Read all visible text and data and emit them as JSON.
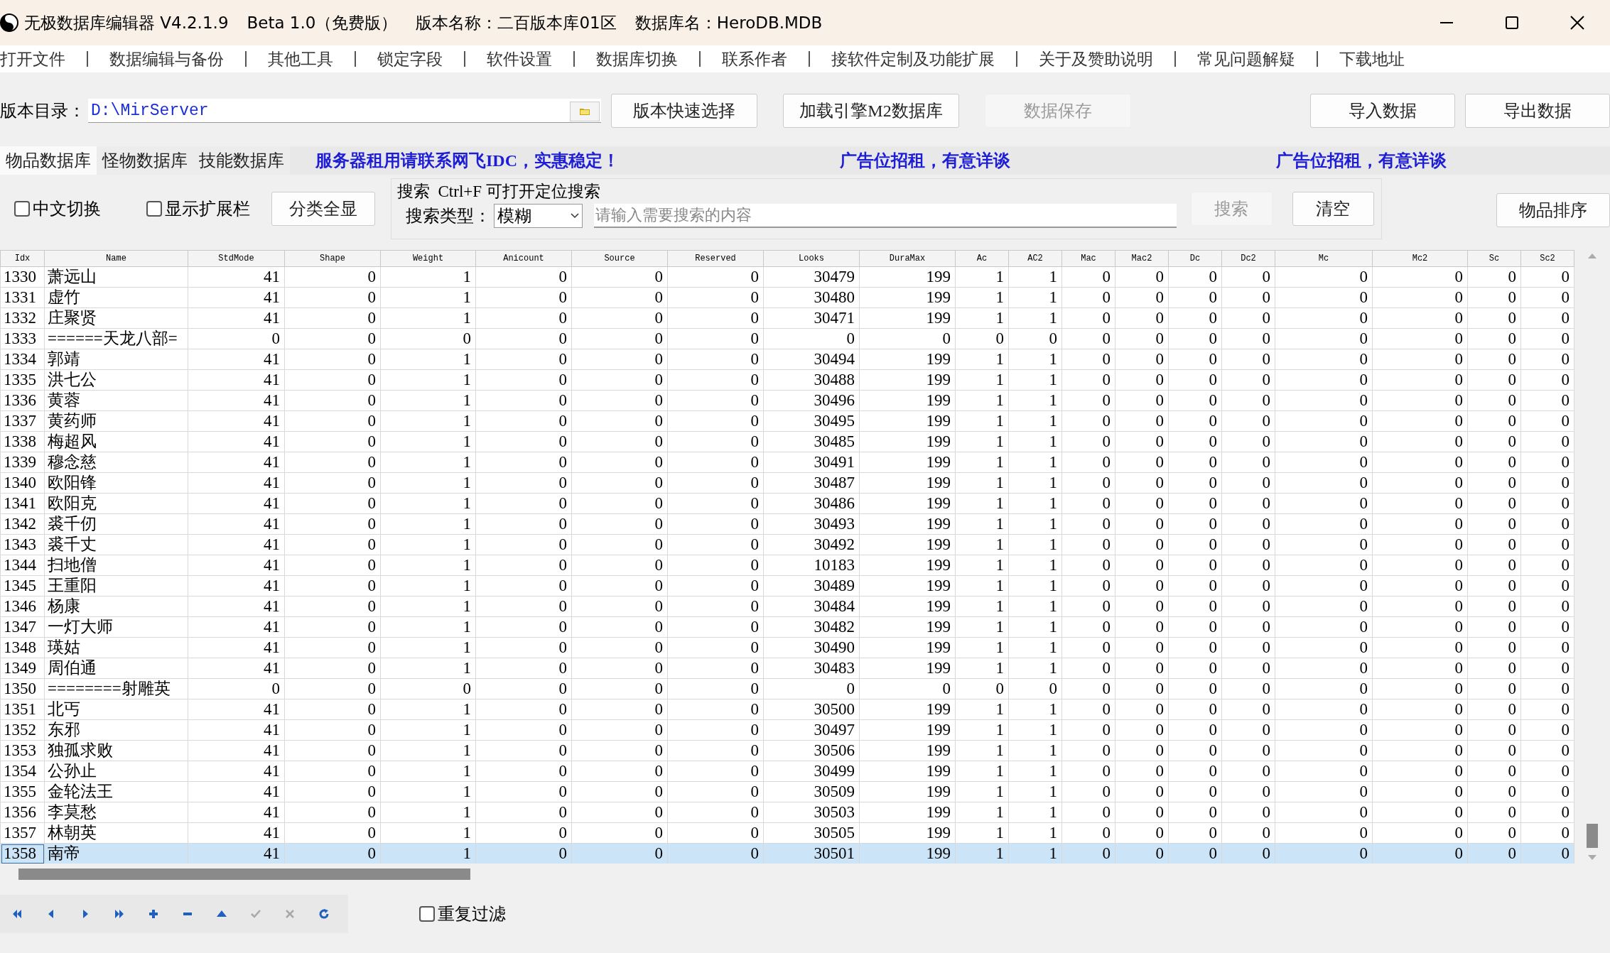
{
  "window": {
    "title": "无极数据库编辑器 V4.2.1.9",
    "edition": "Beta 1.0（免费版）",
    "version_label": "版本名称：二百版本库01区",
    "db_label": "数据库名：HeroDB.MDB"
  },
  "menu": [
    "打开文件",
    "数据编辑与备份",
    "其他工具",
    "锁定字段",
    "软件设置",
    "数据库切换",
    "联系作者",
    "接软件定制及功能扩展",
    "关于及赞助说明",
    "常见问题解疑",
    "下载地址"
  ],
  "toolbar": {
    "dir_label": "版本目录：",
    "dir_value": "D:\\MirServer",
    "buttons": [
      {
        "label": "版本快速选择",
        "disabled": false
      },
      {
        "label": "加载引擎M2数据库",
        "disabled": false
      },
      {
        "label": "数据保存",
        "disabled": true
      }
    ],
    "right_buttons": [
      {
        "label": "导入数据",
        "disabled": false
      },
      {
        "label": "导出数据",
        "disabled": false
      }
    ]
  },
  "tabs": [
    {
      "label": "物品数据库",
      "selected": true
    },
    {
      "label": "怪物数据库",
      "selected": false
    },
    {
      "label": "技能数据库",
      "selected": false
    }
  ],
  "ads": [
    "服务器租用请联系网飞IDC，实惠稳定！",
    "广告位招租，有意详谈",
    "广告位招租，有意详谈"
  ],
  "options": [
    {
      "label": "中文切换",
      "checked": false
    },
    {
      "label": "显示扩展栏",
      "checked": false
    }
  ],
  "show_all_button": "分类全显",
  "search": {
    "title": "搜索  Ctrl+F 可打开定位搜索",
    "type_label": "搜索类型：",
    "type_value": "模糊",
    "placeholder": "请输入需要搜索的内容",
    "buttons": [
      {
        "label": "搜索",
        "disabled": true
      },
      {
        "label": "清空",
        "disabled": false
      }
    ]
  },
  "sort_button": "物品排序",
  "table": {
    "columns": [
      "Idx",
      "Name",
      "StdMode",
      "Shape",
      "Weight",
      "Anicount",
      "Source",
      "Reserved",
      "Looks",
      "DuraMax",
      "Ac",
      "AC2",
      "Mac",
      "Mac2",
      "Dc",
      "Dc2",
      "Mc",
      "Mc2",
      "Sc",
      "Sc2"
    ],
    "rows": [
      {
        "selected": false,
        "cells": [
          "1330",
          "萧远山",
          "41",
          "0",
          "1",
          "0",
          "0",
          "0",
          "30479",
          "199",
          "1",
          "1",
          "0",
          "0",
          "0",
          "0",
          "0",
          "0",
          "0",
          "0"
        ]
      },
      {
        "selected": false,
        "cells": [
          "1331",
          "虚竹",
          "41",
          "0",
          "1",
          "0",
          "0",
          "0",
          "30480",
          "199",
          "1",
          "1",
          "0",
          "0",
          "0",
          "0",
          "0",
          "0",
          "0",
          "0"
        ]
      },
      {
        "selected": false,
        "cells": [
          "1332",
          "庄聚贤",
          "41",
          "0",
          "1",
          "0",
          "0",
          "0",
          "30471",
          "199",
          "1",
          "1",
          "0",
          "0",
          "0",
          "0",
          "0",
          "0",
          "0",
          "0"
        ]
      },
      {
        "selected": false,
        "cells": [
          "1333",
          "======天龙八部=",
          "0",
          "0",
          "0",
          "0",
          "0",
          "0",
          "0",
          "0",
          "0",
          "0",
          "0",
          "0",
          "0",
          "0",
          "0",
          "0",
          "0",
          "0"
        ]
      },
      {
        "selected": false,
        "cells": [
          "1334",
          "郭靖",
          "41",
          "0",
          "1",
          "0",
          "0",
          "0",
          "30494",
          "199",
          "1",
          "1",
          "0",
          "0",
          "0",
          "0",
          "0",
          "0",
          "0",
          "0"
        ]
      },
      {
        "selected": false,
        "cells": [
          "1335",
          "洪七公",
          "41",
          "0",
          "1",
          "0",
          "0",
          "0",
          "30488",
          "199",
          "1",
          "1",
          "0",
          "0",
          "0",
          "0",
          "0",
          "0",
          "0",
          "0"
        ]
      },
      {
        "selected": false,
        "cells": [
          "1336",
          "黄蓉",
          "41",
          "0",
          "1",
          "0",
          "0",
          "0",
          "30496",
          "199",
          "1",
          "1",
          "0",
          "0",
          "0",
          "0",
          "0",
          "0",
          "0",
          "0"
        ]
      },
      {
        "selected": false,
        "cells": [
          "1337",
          "黄药师",
          "41",
          "0",
          "1",
          "0",
          "0",
          "0",
          "30495",
          "199",
          "1",
          "1",
          "0",
          "0",
          "0",
          "0",
          "0",
          "0",
          "0",
          "0"
        ]
      },
      {
        "selected": false,
        "cells": [
          "1338",
          "梅超风",
          "41",
          "0",
          "1",
          "0",
          "0",
          "0",
          "30485",
          "199",
          "1",
          "1",
          "0",
          "0",
          "0",
          "0",
          "0",
          "0",
          "0",
          "0"
        ]
      },
      {
        "selected": false,
        "cells": [
          "1339",
          "穆念慈",
          "41",
          "0",
          "1",
          "0",
          "0",
          "0",
          "30491",
          "199",
          "1",
          "1",
          "0",
          "0",
          "0",
          "0",
          "0",
          "0",
          "0",
          "0"
        ]
      },
      {
        "selected": false,
        "cells": [
          "1340",
          "欧阳锋",
          "41",
          "0",
          "1",
          "0",
          "0",
          "0",
          "30487",
          "199",
          "1",
          "1",
          "0",
          "0",
          "0",
          "0",
          "0",
          "0",
          "0",
          "0"
        ]
      },
      {
        "selected": false,
        "cells": [
          "1341",
          "欧阳克",
          "41",
          "0",
          "1",
          "0",
          "0",
          "0",
          "30486",
          "199",
          "1",
          "1",
          "0",
          "0",
          "0",
          "0",
          "0",
          "0",
          "0",
          "0"
        ]
      },
      {
        "selected": false,
        "cells": [
          "1342",
          "裘千仞",
          "41",
          "0",
          "1",
          "0",
          "0",
          "0",
          "30493",
          "199",
          "1",
          "1",
          "0",
          "0",
          "0",
          "0",
          "0",
          "0",
          "0",
          "0"
        ]
      },
      {
        "selected": false,
        "cells": [
          "1343",
          "裘千丈",
          "41",
          "0",
          "1",
          "0",
          "0",
          "0",
          "30492",
          "199",
          "1",
          "1",
          "0",
          "0",
          "0",
          "0",
          "0",
          "0",
          "0",
          "0"
        ]
      },
      {
        "selected": false,
        "cells": [
          "1344",
          "扫地僧",
          "41",
          "0",
          "1",
          "0",
          "0",
          "0",
          "10183",
          "199",
          "1",
          "1",
          "0",
          "0",
          "0",
          "0",
          "0",
          "0",
          "0",
          "0"
        ]
      },
      {
        "selected": false,
        "cells": [
          "1345",
          "王重阳",
          "41",
          "0",
          "1",
          "0",
          "0",
          "0",
          "30489",
          "199",
          "1",
          "1",
          "0",
          "0",
          "0",
          "0",
          "0",
          "0",
          "0",
          "0"
        ]
      },
      {
        "selected": false,
        "cells": [
          "1346",
          "杨康",
          "41",
          "0",
          "1",
          "0",
          "0",
          "0",
          "30484",
          "199",
          "1",
          "1",
          "0",
          "0",
          "0",
          "0",
          "0",
          "0",
          "0",
          "0"
        ]
      },
      {
        "selected": false,
        "cells": [
          "1347",
          "一灯大师",
          "41",
          "0",
          "1",
          "0",
          "0",
          "0",
          "30482",
          "199",
          "1",
          "1",
          "0",
          "0",
          "0",
          "0",
          "0",
          "0",
          "0",
          "0"
        ]
      },
      {
        "selected": false,
        "cells": [
          "1348",
          "瑛姑",
          "41",
          "0",
          "1",
          "0",
          "0",
          "0",
          "30490",
          "199",
          "1",
          "1",
          "0",
          "0",
          "0",
          "0",
          "0",
          "0",
          "0",
          "0"
        ]
      },
      {
        "selected": false,
        "cells": [
          "1349",
          "周伯通",
          "41",
          "0",
          "1",
          "0",
          "0",
          "0",
          "30483",
          "199",
          "1",
          "1",
          "0",
          "0",
          "0",
          "0",
          "0",
          "0",
          "0",
          "0"
        ]
      },
      {
        "selected": false,
        "cells": [
          "1350",
          "========射雕英",
          "0",
          "0",
          "0",
          "0",
          "0",
          "0",
          "0",
          "0",
          "0",
          "0",
          "0",
          "0",
          "0",
          "0",
          "0",
          "0",
          "0",
          "0"
        ]
      },
      {
        "selected": false,
        "cells": [
          "1351",
          "北丐",
          "41",
          "0",
          "1",
          "0",
          "0",
          "0",
          "30500",
          "199",
          "1",
          "1",
          "0",
          "0",
          "0",
          "0",
          "0",
          "0",
          "0",
          "0"
        ]
      },
      {
        "selected": false,
        "cells": [
          "1352",
          "东邪",
          "41",
          "0",
          "1",
          "0",
          "0",
          "0",
          "30497",
          "199",
          "1",
          "1",
          "0",
          "0",
          "0",
          "0",
          "0",
          "0",
          "0",
          "0"
        ]
      },
      {
        "selected": false,
        "cells": [
          "1353",
          "独孤求败",
          "41",
          "0",
          "1",
          "0",
          "0",
          "0",
          "30506",
          "199",
          "1",
          "1",
          "0",
          "0",
          "0",
          "0",
          "0",
          "0",
          "0",
          "0"
        ]
      },
      {
        "selected": false,
        "cells": [
          "1354",
          "公孙止",
          "41",
          "0",
          "1",
          "0",
          "0",
          "0",
          "30499",
          "199",
          "1",
          "1",
          "0",
          "0",
          "0",
          "0",
          "0",
          "0",
          "0",
          "0"
        ]
      },
      {
        "selected": false,
        "cells": [
          "1355",
          "金轮法王",
          "41",
          "0",
          "1",
          "0",
          "0",
          "0",
          "30509",
          "199",
          "1",
          "1",
          "0",
          "0",
          "0",
          "0",
          "0",
          "0",
          "0",
          "0"
        ]
      },
      {
        "selected": false,
        "cells": [
          "1356",
          "李莫愁",
          "41",
          "0",
          "1",
          "0",
          "0",
          "0",
          "30503",
          "199",
          "1",
          "1",
          "0",
          "0",
          "0",
          "0",
          "0",
          "0",
          "0",
          "0"
        ]
      },
      {
        "selected": false,
        "cells": [
          "1357",
          "林朝英",
          "41",
          "0",
          "1",
          "0",
          "0",
          "0",
          "30505",
          "199",
          "1",
          "1",
          "0",
          "0",
          "0",
          "0",
          "0",
          "0",
          "0",
          "0"
        ]
      },
      {
        "selected": true,
        "cells": [
          "1358",
          "南帝",
          "41",
          "0",
          "1",
          "0",
          "0",
          "0",
          "30501",
          "199",
          "1",
          "1",
          "0",
          "0",
          "0",
          "0",
          "0",
          "0",
          "0",
          "0"
        ]
      }
    ]
  },
  "navigator": [
    {
      "kind": "first",
      "disabled": false
    },
    {
      "kind": "prior",
      "disabled": false
    },
    {
      "kind": "next",
      "disabled": false
    },
    {
      "kind": "last",
      "disabled": false
    },
    {
      "kind": "insert",
      "disabled": false
    },
    {
      "kind": "delete",
      "disabled": false
    },
    {
      "kind": "edit",
      "disabled": false
    },
    {
      "kind": "post",
      "disabled": true
    },
    {
      "kind": "cancel",
      "disabled": true
    },
    {
      "kind": "refresh",
      "disabled": false
    }
  ],
  "filter": {
    "label": "重复过滤",
    "checked": false
  }
}
